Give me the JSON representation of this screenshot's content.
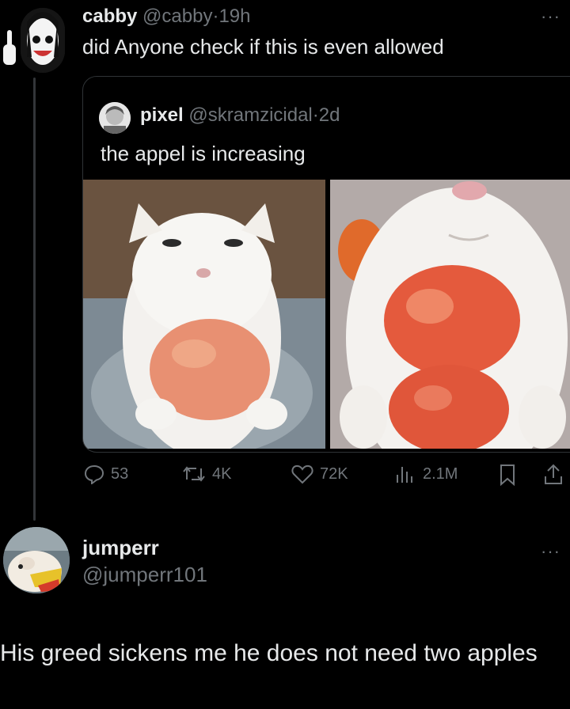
{
  "main_tweet": {
    "name": "cabby",
    "handle": "@cabby",
    "time": "·19h",
    "text": "did Anyone check if this is even allowed",
    "more_icon": "more-icon",
    "more_label": "···"
  },
  "quoted_tweet": {
    "name": "pixel",
    "handle": "@skramzicidal",
    "time": "·2d",
    "text": "the appel is increasing",
    "images": [
      {
        "name": "cat-with-one-apple-image"
      },
      {
        "name": "cat-with-two-apples-image"
      }
    ]
  },
  "actions": {
    "reply_count": "53",
    "retweet_count": "4K",
    "like_count": "72K",
    "views_count": "2.1M"
  },
  "reply": {
    "name": "jumperr",
    "handle": "@jumperr101",
    "text": "His greed sickens me he does not need two apples",
    "more_label": "···"
  }
}
